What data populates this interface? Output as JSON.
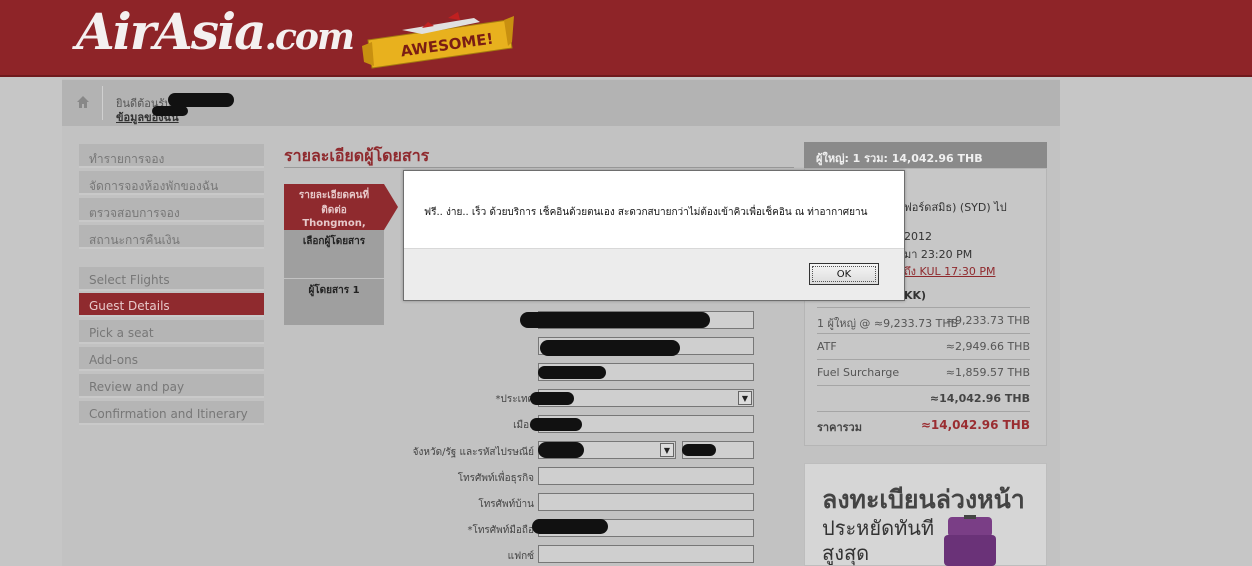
{
  "header": {
    "logo_main": "AirAsia",
    "logo_suffix": ".com",
    "badge": "AWESOME!"
  },
  "welcome": {
    "greeting": "ยินดีต้อนรับ",
    "my_account": "ข้อมูลของฉัน"
  },
  "menu": {
    "account_items": [
      {
        "label": "ทำรายการจอง"
      },
      {
        "label": "จัดการจองห้องพักของฉัน"
      },
      {
        "label": "ตรวจสอบการจอง"
      },
      {
        "label": "สถานะการคืนเงิน"
      }
    ],
    "steps": [
      {
        "label": "Select Flights"
      },
      {
        "label": "Guest Details",
        "active": true
      },
      {
        "label": "Pick a seat"
      },
      {
        "label": "Add-ons"
      },
      {
        "label": "Review and pay"
      },
      {
        "label": "Confirmation and Itinerary"
      }
    ]
  },
  "main": {
    "title": "รายละเอียดผู้โดยสาร",
    "tab_contact_line1": "รายละเอียดคนที่",
    "tab_contact_line2": "ติดต่อ",
    "tab_contact_line3": "Thongmon,",
    "tab_select": "เลือกผู้โดยสาร",
    "tab_passenger": "ผู้โดยสาร 1",
    "labels": {
      "country": "*ประเทศ",
      "city": "เมือง",
      "state_zip": "จังหวัด/รัฐ และรหัสไปรษณีย์",
      "business_phone": "โทรศัพท์เพื่อธุรกิจ",
      "home_phone": "โทรศัพท์บ้าน",
      "mobile": "*โทรศัพท์มือถือ",
      "fax": "แฟกซ์"
    }
  },
  "summary": {
    "header": "ผู้ใหญ่: 1  รวม: 14,042.96 THB",
    "route": "ฟอร์ดสมิธ) (SYD) ไป",
    "date": "2012",
    "time": "มา 23:20 PM",
    "connection": "ถึง KUL 17:30 PM",
    "currency_note": "KK)",
    "rows": [
      {
        "label": "1 ผู้ใหญ่ @ ≈9,233.73 THB",
        "value": "≈9,233.73 THB"
      },
      {
        "label": "ATF",
        "value": "≈2,949.66 THB"
      },
      {
        "label": "Fuel Surcharge",
        "value": "≈1,859.57 THB"
      }
    ],
    "subtotal": "≈14,042.96 THB",
    "total_label": "ราคารวม",
    "total_value": "≈14,042.96 THB"
  },
  "promo": {
    "line1": "ลงทะเบียนล่วงหน้า",
    "line2": "ประหยัดทันที",
    "line3": "สูงสุด"
  },
  "modal": {
    "message": "ฟรี.. ง่าย.. เร็ว ด้วยบริการ เช็คอินด้วยตนเอง สะดวกสบายกว่าไม่ต้องเข้าคิวเพื่อเช็คอิน ณ ท่าอากาศยาน",
    "ok_label": "OK"
  }
}
